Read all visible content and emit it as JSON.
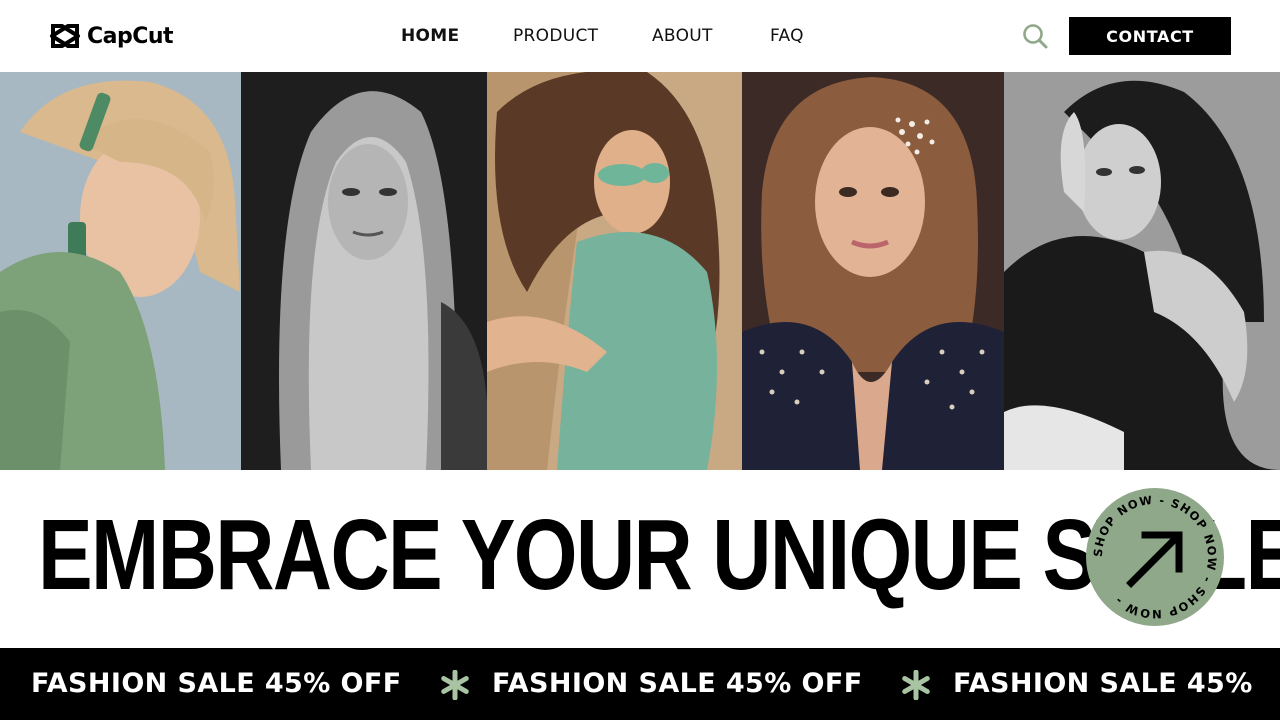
{
  "brand": {
    "name": "CapCut",
    "logo_icon": "capcut-logo-icon"
  },
  "nav": {
    "items": [
      {
        "label": "HOME",
        "active": true
      },
      {
        "label": "PRODUCT",
        "active": false
      },
      {
        "label": "ABOUT",
        "active": false
      },
      {
        "label": "FAQ",
        "active": false
      }
    ]
  },
  "header": {
    "search_icon": "search-icon",
    "contact_label": "CONTACT"
  },
  "gallery": {
    "photos": [
      {
        "subject": "model-portrait-green-top"
      },
      {
        "subject": "model-portrait-monochrome-long-hair"
      },
      {
        "subject": "model-portrait-green-sunglasses"
      },
      {
        "subject": "model-portrait-pearl-jacket"
      },
      {
        "subject": "model-portrait-monochrome-black-top"
      }
    ]
  },
  "hero": {
    "headline": "EMBRACE YOUR UNIQUE STYLE",
    "badge_text": "SHOP NOW - SHOP NOW - SHOP NOW - ",
    "badge_icon": "arrow-up-right-icon"
  },
  "ticker": {
    "items": [
      "FASHION SALE 45% OFF",
      "FASHION SALE 45% OFF",
      "FASHION SALE 45%"
    ],
    "separator_icon": "asterisk-icon"
  },
  "colors": {
    "accent_green": "#8fa889",
    "black": "#000000",
    "white": "#ffffff",
    "ticker_star": "#a8c4a2"
  }
}
